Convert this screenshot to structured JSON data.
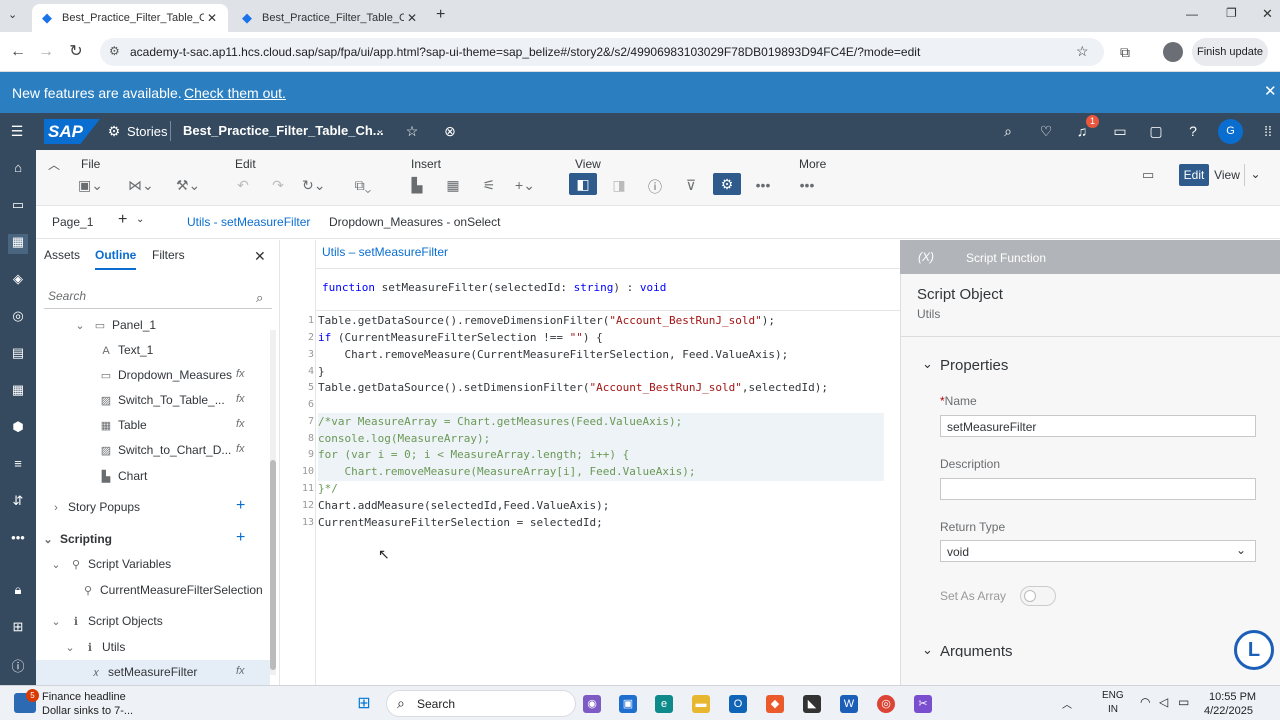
{
  "browser": {
    "tabs": [
      {
        "label": "Best_Practice_Filter_Table_Chart",
        "active": true
      },
      {
        "label": "Best_Practice_Filter_Table_Chart",
        "active": false
      }
    ],
    "url": "academy-t-sac.ap11.hcs.cloud.sap/sap/fpa/ui/app.html?sap-ui-theme=sap_belize#/story2&/s2/49906983103029F78DB019893D94FC4E/?mode=edit",
    "finish_update": "Finish update"
  },
  "banner": {
    "text": "New features are available.",
    "link": "Check them out."
  },
  "shell": {
    "logo": "SAP",
    "stories": "Stories",
    "story_title": "Best_Practice_Filter_Table_Ch...",
    "notification_count": "1",
    "avatar": "G"
  },
  "toolbar": {
    "groups": [
      "File",
      "Edit",
      "Insert",
      "View",
      "More"
    ],
    "edit_label": "Edit",
    "view_label": "View"
  },
  "pagetabs": {
    "page": "Page_1",
    "tabs": [
      "Utils - setMeasureFilter",
      "Dropdown_Measures - onSelect"
    ]
  },
  "leftpanel": {
    "tabs": [
      "Assets",
      "Outline",
      "Filters"
    ],
    "search_placeholder": "Search",
    "tree": {
      "panel": "Panel_1",
      "text": "Text_1",
      "dropdown": "Dropdown_Measures",
      "switch_table": "Switch_To_Table_...",
      "table": "Table",
      "switch_chart": "Switch_to_Chart_D...",
      "chart": "Chart",
      "story_popups": "Story Popups",
      "scripting": "Scripting",
      "script_variables": "Script Variables",
      "current_var": "CurrentMeasureFilterSelection",
      "script_objects": "Script Objects",
      "utils": "Utils",
      "set_measure": "setMeasureFilter"
    },
    "fx_label": "fx"
  },
  "editor": {
    "breadcrumb": "Utils – setMeasureFilter",
    "signature_kw": "function",
    "signature_name": "setMeasureFilter(selectedId: ",
    "signature_type": "string",
    "signature_ret": ") : ",
    "signature_void": "void",
    "lines": {
      "l1a": "Table.getDataSource().removeDimensionFilter(",
      "l1s": "\"Account_BestRunJ_sold\"",
      "l1b": ");",
      "l2a": "if",
      "l2b": " (CurrentMeasureFilterSelection !== ",
      "l2s": "\"\"",
      "l2c": ") {",
      "l3": "    Chart.removeMeasure(CurrentMeasureFilterSelection, Feed.ValueAxis);",
      "l4": "}",
      "l5a": "Table.getDataSource().setDimensionFilter(",
      "l5s": "\"Account_BestRunJ_sold\"",
      "l5b": ",selectedId);",
      "l7": "/*var MeasureArray = Chart.getMeasures(Feed.ValueAxis);",
      "l8": "console.log(MeasureArray);",
      "l9": "for (var i = 0; i < MeasureArray.length; i++) {",
      "l10": "    Chart.removeMeasure(MeasureArray[i], Feed.ValueAxis);",
      "l11": "}*/",
      "l12": "Chart.addMeasure(selectedId,Feed.ValueAxis);",
      "l13": "CurrentMeasureFilterSelection = selectedId;"
    },
    "line_numbers": [
      "1",
      "2",
      "3",
      "4",
      "5",
      "6",
      "7",
      "8",
      "9",
      "10",
      "11",
      "12",
      "13"
    ]
  },
  "rightpanel": {
    "header_symbol": "(X)",
    "header": "Script Function",
    "object_title": "Script Object",
    "object_sub": "Utils",
    "properties": "Properties",
    "required_mark": "*",
    "name_label": "Name",
    "name_value": "setMeasureFilter",
    "description_label": "Description",
    "description_value": "",
    "return_type_label": "Return Type",
    "return_type_value": "void",
    "set_as_array_label": "Set As Array",
    "arguments_label": "Arguments"
  },
  "taskbar": {
    "news_title": "Finance headline",
    "news_sub": "Dollar sinks to 7-...",
    "news_badge": "5",
    "search": "Search",
    "lang1": "ENG",
    "lang2": "IN",
    "time": "10:55 PM",
    "date": "4/22/2025"
  }
}
